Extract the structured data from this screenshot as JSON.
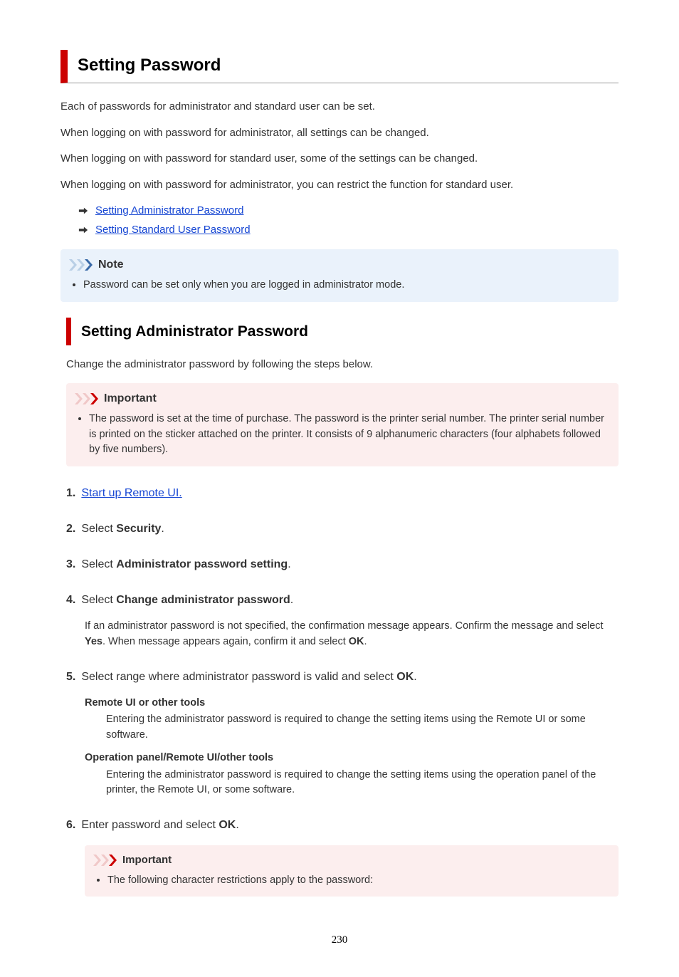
{
  "title": "Setting Password",
  "intro": [
    "Each of passwords for administrator and standard user can be set.",
    "When logging on with password for administrator, all settings can be changed.",
    "When logging on with password for standard user, some of the settings can be changed.",
    "When logging on with password for administrator, you can restrict the function for standard user."
  ],
  "links": [
    "Setting Administrator Password",
    "Setting Standard User Password"
  ],
  "note": {
    "label": "Note",
    "items": [
      "Password can be set only when you are logged in administrator mode."
    ]
  },
  "section": {
    "heading": "Setting Administrator Password",
    "lead": "Change the administrator password by following the steps below."
  },
  "important1": {
    "label": "Important",
    "items": [
      "The password is set at the time of purchase. The password is the printer serial number. The printer serial number is printed on the sticker attached on the printer. It consists of 9 alphanumeric characters (four alphabets followed by five numbers)."
    ]
  },
  "steps": {
    "s1_link": "Start up Remote UI.",
    "s2_pre": "Select ",
    "s2_bold": "Security",
    "s3_pre": "Select ",
    "s3_bold": "Administrator password setting",
    "s4_pre": "Select ",
    "s4_bold": "Change administrator password",
    "s4_body_a": "If an administrator password is not specified, the confirmation message appears. Confirm the message and select ",
    "s4_body_b": "Yes",
    "s4_body_c": ". When message appears again, confirm it and select ",
    "s4_body_d": "OK",
    "s5_pre": "Select range where administrator password is valid and select ",
    "s5_bold": "OK",
    "s5_dt1": "Remote UI or other tools",
    "s5_dd1": "Entering the administrator password is required to change the setting items using the Remote UI or some software.",
    "s5_dt2": "Operation panel/Remote UI/other tools",
    "s5_dd2": "Entering the administrator password is required to change the setting items using the operation panel of the printer, the Remote UI, or some software.",
    "s6_pre": "Enter password and select ",
    "s6_bold": "OK"
  },
  "important2": {
    "label": "Important",
    "items": [
      "The following character restrictions apply to the password:"
    ]
  },
  "pageNumber": "230"
}
